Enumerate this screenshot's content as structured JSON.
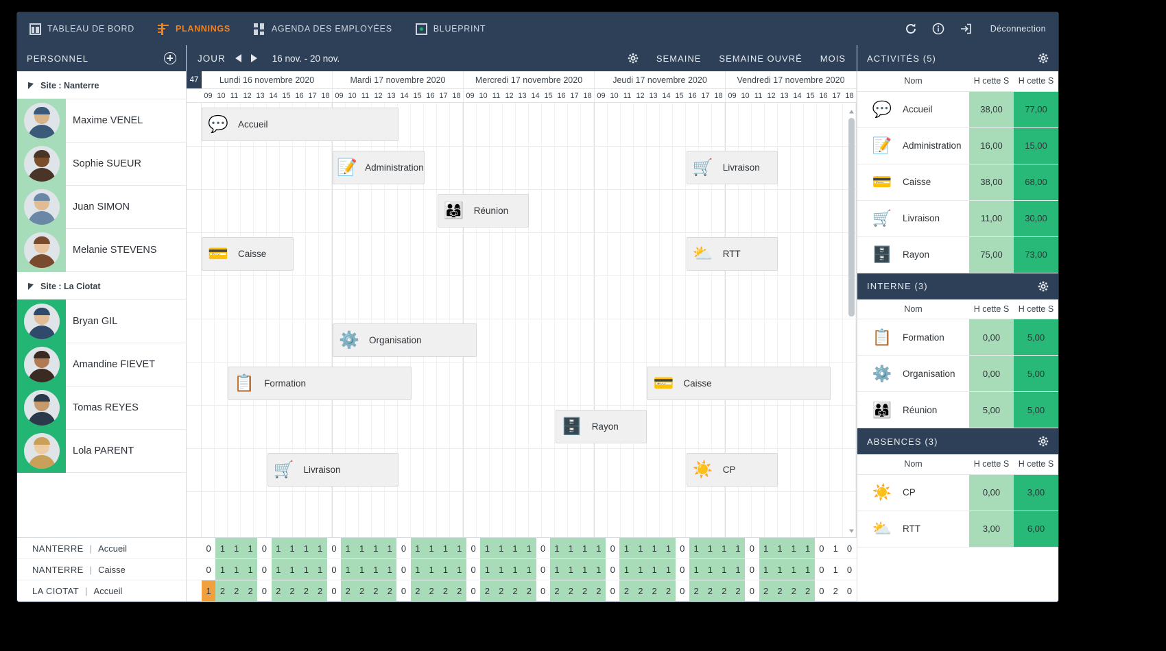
{
  "nav": {
    "items": [
      {
        "label": "TABLEAU DE BORD",
        "icon": "dashboard-icon",
        "active": false
      },
      {
        "label": "PLANNINGS",
        "icon": "planning-icon",
        "active": true
      },
      {
        "label": "AGENDA DES EMPLOYÉES",
        "icon": "agenda-icon",
        "active": false
      },
      {
        "label": "BLUEPRINT",
        "icon": "blueprint-icon",
        "active": false
      }
    ],
    "refresh_icon": "refresh-icon",
    "info_icon": "info-icon",
    "logout_icon": "logout-icon",
    "logout_label": "Déconnection"
  },
  "sidebar": {
    "title": "PERSONNEL",
    "add_icon": "plus-icon",
    "groups": [
      {
        "label": "Site : Nanterre",
        "accent": "#a6dcba",
        "people": [
          {
            "name": "Maxime VENEL"
          },
          {
            "name": "Sophie SUEUR"
          },
          {
            "name": "Juan SIMON"
          },
          {
            "name": "Melanie STEVENS"
          }
        ]
      },
      {
        "label": "Site : La Ciotat",
        "accent": "#22b573",
        "people": [
          {
            "name": "Bryan GIL"
          },
          {
            "name": "Amandine FIEVET"
          },
          {
            "name": "Tomas REYES"
          },
          {
            "name": "Lola PARENT"
          }
        ]
      }
    ],
    "summary_rows": [
      {
        "site": "NANTERRE",
        "sep": "|",
        "activity": "Accueil"
      },
      {
        "site": "NANTERRE",
        "sep": "|",
        "activity": "Caisse"
      },
      {
        "site": "LA CIOTAT",
        "sep": "|",
        "activity": "Accueil"
      }
    ]
  },
  "planning": {
    "mode_label": "JOUR",
    "prev_icon": "arrow-left-icon",
    "next_icon": "arrow-right-icon",
    "date_range": "16 nov. - 20 nov.",
    "settings_icon": "gear-icon",
    "buttons": [
      {
        "label": "SEMAINE"
      },
      {
        "label": "SEMAINE OUVRÉ"
      },
      {
        "label": "MOIS"
      }
    ],
    "week_number": "47",
    "days": [
      "Lundi 16 novembre 2020",
      "Mardi 17 novembre 2020",
      "Mercredi 17 novembre 2020",
      "Jeudi 17 novembre 2020",
      "Vendredi 17 novembre 2020"
    ],
    "hours": [
      "09",
      "10",
      "11",
      "12",
      "13",
      "14",
      "15",
      "16",
      "17",
      "18"
    ],
    "tasks": [
      {
        "label": "Accueil",
        "emoji": "💬",
        "day": 0,
        "start": 0,
        "span": 15,
        "row": 0
      },
      {
        "label": "Administration",
        "emoji": "📝",
        "day": 1,
        "start": 0,
        "span": 7,
        "row": 1
      },
      {
        "label": "Livraison",
        "emoji": "🛒",
        "day": 3,
        "start": 7,
        "span": 7,
        "row": 1
      },
      {
        "label": "Réunion",
        "emoji": "👨‍👩‍👧",
        "day": 1,
        "start": 8,
        "span": 7,
        "row": 2
      },
      {
        "label": "Caisse",
        "emoji": "💳",
        "day": 0,
        "start": 0,
        "span": 7,
        "row": 3
      },
      {
        "label": "RTT",
        "emoji": "⛅",
        "day": 3,
        "start": 7,
        "span": 7,
        "row": 3
      },
      {
        "label": "Organisation",
        "emoji": "⚙️",
        "day": 1,
        "start": 0,
        "span": 11,
        "row": 5
      },
      {
        "label": "Formation",
        "emoji": "📋",
        "day": 0,
        "start": 2,
        "span": 14,
        "row": 6
      },
      {
        "label": "Caisse",
        "emoji": "💳",
        "day": 3,
        "start": 4,
        "span": 14,
        "row": 6
      },
      {
        "label": "Rayon",
        "emoji": "🗄️",
        "day": 2,
        "start": 7,
        "span": 7,
        "row": 7
      },
      {
        "label": "Livraison",
        "emoji": "🛒",
        "day": 0,
        "start": 5,
        "span": 10,
        "row": 8
      },
      {
        "label": "CP",
        "emoji": "☀️",
        "day": 3,
        "start": 7,
        "span": 7,
        "row": 8
      }
    ],
    "count_rows": [
      {
        "cells": [
          {
            "v": "0",
            "s": "n"
          },
          {
            "v": "1",
            "s": "g"
          },
          {
            "v": "1",
            "s": "g"
          },
          {
            "v": "1",
            "s": "g"
          },
          {
            "v": "0",
            "s": "n"
          },
          {
            "v": "1",
            "s": "g"
          },
          {
            "v": "1",
            "s": "g"
          },
          {
            "v": "1",
            "s": "g"
          },
          {
            "v": "1",
            "s": "g"
          },
          {
            "v": "0",
            "s": "n"
          },
          {
            "v": "1",
            "s": "g"
          },
          {
            "v": "1",
            "s": "g"
          },
          {
            "v": "1",
            "s": "g"
          },
          {
            "v": "1",
            "s": "g"
          },
          {
            "v": "0",
            "s": "n"
          },
          {
            "v": "1",
            "s": "g"
          },
          {
            "v": "1",
            "s": "g"
          },
          {
            "v": "1",
            "s": "g"
          },
          {
            "v": "1",
            "s": "g"
          },
          {
            "v": "0",
            "s": "n"
          },
          {
            "v": "1",
            "s": "g"
          },
          {
            "v": "1",
            "s": "g"
          },
          {
            "v": "1",
            "s": "g"
          },
          {
            "v": "1",
            "s": "g"
          },
          {
            "v": "0",
            "s": "n"
          },
          {
            "v": "1",
            "s": "g"
          },
          {
            "v": "1",
            "s": "g"
          },
          {
            "v": "1",
            "s": "g"
          },
          {
            "v": "1",
            "s": "g"
          },
          {
            "v": "0",
            "s": "n"
          },
          {
            "v": "1",
            "s": "g"
          },
          {
            "v": "1",
            "s": "g"
          },
          {
            "v": "1",
            "s": "g"
          },
          {
            "v": "1",
            "s": "g"
          },
          {
            "v": "0",
            "s": "n"
          },
          {
            "v": "1",
            "s": "g"
          },
          {
            "v": "1",
            "s": "g"
          },
          {
            "v": "1",
            "s": "g"
          },
          {
            "v": "1",
            "s": "g"
          },
          {
            "v": "0",
            "s": "n"
          },
          {
            "v": "1",
            "s": "g"
          },
          {
            "v": "1",
            "s": "g"
          },
          {
            "v": "1",
            "s": "g"
          },
          {
            "v": "1",
            "s": "g"
          },
          {
            "v": "0",
            "s": "n"
          },
          {
            "v": "1",
            "s": "n"
          },
          {
            "v": "0",
            "s": "n"
          }
        ]
      },
      {
        "cells": [
          {
            "v": "0",
            "s": "n"
          },
          {
            "v": "1",
            "s": "g"
          },
          {
            "v": "1",
            "s": "g"
          },
          {
            "v": "1",
            "s": "g"
          },
          {
            "v": "0",
            "s": "n"
          },
          {
            "v": "1",
            "s": "g"
          },
          {
            "v": "1",
            "s": "g"
          },
          {
            "v": "1",
            "s": "g"
          },
          {
            "v": "1",
            "s": "g"
          },
          {
            "v": "0",
            "s": "n"
          },
          {
            "v": "1",
            "s": "g"
          },
          {
            "v": "1",
            "s": "g"
          },
          {
            "v": "1",
            "s": "g"
          },
          {
            "v": "1",
            "s": "g"
          },
          {
            "v": "0",
            "s": "n"
          },
          {
            "v": "1",
            "s": "g"
          },
          {
            "v": "1",
            "s": "g"
          },
          {
            "v": "1",
            "s": "g"
          },
          {
            "v": "1",
            "s": "g"
          },
          {
            "v": "0",
            "s": "n"
          },
          {
            "v": "1",
            "s": "g"
          },
          {
            "v": "1",
            "s": "g"
          },
          {
            "v": "1",
            "s": "g"
          },
          {
            "v": "1",
            "s": "g"
          },
          {
            "v": "0",
            "s": "n"
          },
          {
            "v": "1",
            "s": "g"
          },
          {
            "v": "1",
            "s": "g"
          },
          {
            "v": "1",
            "s": "g"
          },
          {
            "v": "1",
            "s": "g"
          },
          {
            "v": "0",
            "s": "n"
          },
          {
            "v": "1",
            "s": "g"
          },
          {
            "v": "1",
            "s": "g"
          },
          {
            "v": "1",
            "s": "g"
          },
          {
            "v": "1",
            "s": "g"
          },
          {
            "v": "0",
            "s": "n"
          },
          {
            "v": "1",
            "s": "g"
          },
          {
            "v": "1",
            "s": "g"
          },
          {
            "v": "1",
            "s": "g"
          },
          {
            "v": "1",
            "s": "g"
          },
          {
            "v": "0",
            "s": "n"
          },
          {
            "v": "1",
            "s": "g"
          },
          {
            "v": "1",
            "s": "g"
          },
          {
            "v": "1",
            "s": "g"
          },
          {
            "v": "1",
            "s": "g"
          },
          {
            "v": "0",
            "s": "n"
          },
          {
            "v": "1",
            "s": "n"
          },
          {
            "v": "0",
            "s": "n"
          }
        ]
      },
      {
        "cells": [
          {
            "v": "1",
            "s": "o"
          },
          {
            "v": "2",
            "s": "g"
          },
          {
            "v": "2",
            "s": "g"
          },
          {
            "v": "2",
            "s": "g"
          },
          {
            "v": "0",
            "s": "n"
          },
          {
            "v": "2",
            "s": "g"
          },
          {
            "v": "2",
            "s": "g"
          },
          {
            "v": "2",
            "s": "g"
          },
          {
            "v": "2",
            "s": "g"
          },
          {
            "v": "0",
            "s": "n"
          },
          {
            "v": "2",
            "s": "g"
          },
          {
            "v": "2",
            "s": "g"
          },
          {
            "v": "2",
            "s": "g"
          },
          {
            "v": "2",
            "s": "g"
          },
          {
            "v": "0",
            "s": "n"
          },
          {
            "v": "2",
            "s": "g"
          },
          {
            "v": "2",
            "s": "g"
          },
          {
            "v": "2",
            "s": "g"
          },
          {
            "v": "2",
            "s": "g"
          },
          {
            "v": "0",
            "s": "n"
          },
          {
            "v": "2",
            "s": "g"
          },
          {
            "v": "2",
            "s": "g"
          },
          {
            "v": "2",
            "s": "g"
          },
          {
            "v": "2",
            "s": "g"
          },
          {
            "v": "0",
            "s": "n"
          },
          {
            "v": "2",
            "s": "g"
          },
          {
            "v": "2",
            "s": "g"
          },
          {
            "v": "2",
            "s": "g"
          },
          {
            "v": "2",
            "s": "g"
          },
          {
            "v": "0",
            "s": "n"
          },
          {
            "v": "2",
            "s": "g"
          },
          {
            "v": "2",
            "s": "g"
          },
          {
            "v": "2",
            "s": "g"
          },
          {
            "v": "2",
            "s": "g"
          },
          {
            "v": "0",
            "s": "n"
          },
          {
            "v": "2",
            "s": "g"
          },
          {
            "v": "2",
            "s": "g"
          },
          {
            "v": "2",
            "s": "g"
          },
          {
            "v": "2",
            "s": "g"
          },
          {
            "v": "0",
            "s": "n"
          },
          {
            "v": "2",
            "s": "g"
          },
          {
            "v": "2",
            "s": "g"
          },
          {
            "v": "2",
            "s": "g"
          },
          {
            "v": "2",
            "s": "g"
          },
          {
            "v": "0",
            "s": "n"
          },
          {
            "v": "2",
            "s": "n"
          },
          {
            "v": "0",
            "s": "n"
          }
        ]
      }
    ]
  },
  "right_panels": [
    {
      "title": "ACTIVITÉS (5)",
      "gear_icon": "gear-icon",
      "columns": [
        "Nom",
        "H cette S",
        "H cette S"
      ],
      "rows": [
        {
          "emoji": "💬",
          "name": "Accueil",
          "v1": "38,00",
          "v2": "77,00"
        },
        {
          "emoji": "📝",
          "name": "Administration",
          "v1": "16,00",
          "v2": "15,00"
        },
        {
          "emoji": "💳",
          "name": "Caisse",
          "v1": "38,00",
          "v2": "68,00"
        },
        {
          "emoji": "🛒",
          "name": "Livraison",
          "v1": "11,00",
          "v2": "30,00"
        },
        {
          "emoji": "🗄️",
          "name": "Rayon",
          "v1": "75,00",
          "v2": "73,00"
        }
      ]
    },
    {
      "title": "INTERNE (3)",
      "gear_icon": "gear-icon",
      "columns": [
        "Nom",
        "H cette S",
        "H cette S"
      ],
      "rows": [
        {
          "emoji": "📋",
          "name": "Formation",
          "v1": "0,00",
          "v2": "5,00"
        },
        {
          "emoji": "⚙️",
          "name": "Organisation",
          "v1": "0,00",
          "v2": "5,00"
        },
        {
          "emoji": "👨‍👩‍👧",
          "name": "Réunion",
          "v1": "5,00",
          "v2": "5,00"
        }
      ]
    },
    {
      "title": "ABSENCES (3)",
      "gear_icon": "gear-icon",
      "columns": [
        "Nom",
        "H cette S",
        "H cette S"
      ],
      "rows": [
        {
          "emoji": "☀️",
          "name": "CP",
          "v1": "0,00",
          "v2": "3,00"
        },
        {
          "emoji": "⛅",
          "name": "RTT",
          "v1": "3,00",
          "v2": "6,00"
        }
      ]
    }
  ],
  "colors": {
    "header_bg": "#2e4057",
    "accent_orange": "#f0821e",
    "green_light": "#a8dcb8",
    "green_dark": "#28b877",
    "orange_cell": "#f0a03c"
  }
}
